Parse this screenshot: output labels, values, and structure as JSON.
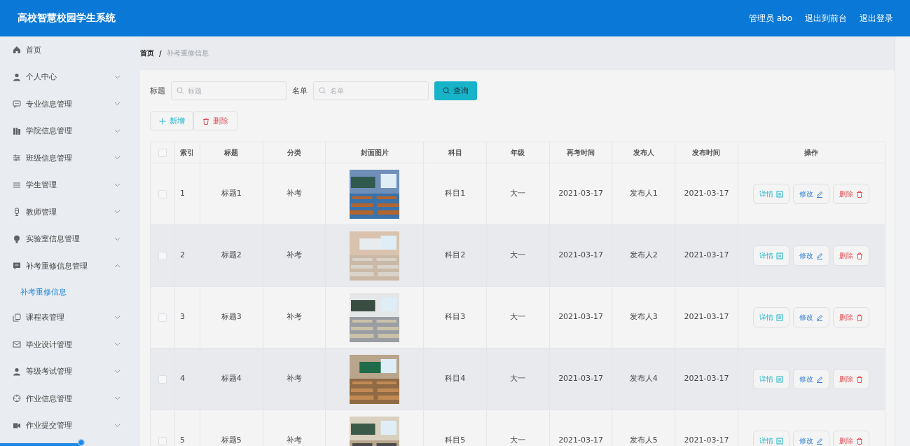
{
  "header": {
    "title": "高校智慧校园学生系统",
    "links": [
      "管理员 abo",
      "退出到前台",
      "退出登录"
    ]
  },
  "sidebar": {
    "items": [
      {
        "label": "首页",
        "kind": "link"
      },
      {
        "label": "个人中心",
        "kind": "submenu",
        "expanded": false
      },
      {
        "label": "专业信息管理",
        "kind": "submenu",
        "expanded": false
      },
      {
        "label": "学院信息管理",
        "kind": "submenu",
        "expanded": false
      },
      {
        "label": "班级信息管理",
        "kind": "submenu",
        "expanded": false
      },
      {
        "label": "学生管理",
        "kind": "submenu",
        "expanded": false
      },
      {
        "label": "教师管理",
        "kind": "submenu",
        "expanded": false
      },
      {
        "label": "实验室信息管理",
        "kind": "submenu",
        "expanded": false
      },
      {
        "label": "补考重修信息管理",
        "kind": "submenu",
        "expanded": true,
        "children": [
          {
            "label": "补考重修信息",
            "selected": true
          }
        ]
      },
      {
        "label": "课程表管理",
        "kind": "submenu",
        "expanded": false
      },
      {
        "label": "毕业设计管理",
        "kind": "submenu",
        "expanded": false
      },
      {
        "label": "等级考试管理",
        "kind": "submenu",
        "expanded": false
      },
      {
        "label": "作业信息管理",
        "kind": "submenu",
        "expanded": false
      },
      {
        "label": "作业提交管理",
        "kind": "submenu",
        "expanded": false
      }
    ]
  },
  "breadcrumb": {
    "separator": "/",
    "items": [
      "首页",
      "补考重修信息"
    ]
  },
  "search": {
    "fields": [
      {
        "label": "标题",
        "placeholder": "标题"
      },
      {
        "label": "名单",
        "placeholder": "名单"
      }
    ],
    "button": "查询"
  },
  "actions": [
    {
      "label": "新增",
      "kind": "add"
    },
    {
      "label": "删除",
      "kind": "delete"
    }
  ],
  "table": {
    "select_all": {
      "checked": false
    },
    "columns": [
      "索引",
      "标题",
      "分类",
      "封面图片",
      "科目",
      "年级",
      "再考时间",
      "发布人",
      "发布时间",
      "操作"
    ],
    "rows": [
      {
        "checked": false,
        "cells": [
          "1",
          "标题1",
          "补考",
          null,
          "科目1",
          "大一",
          "2021-03-17",
          "发布人1",
          "2021-03-17"
        ],
        "actions": [
          {
            "label": "详情",
            "kind": "detail"
          },
          {
            "label": "修改",
            "kind": "edit"
          },
          {
            "label": "删除",
            "kind": "delete"
          }
        ]
      },
      {
        "checked": false,
        "cells": [
          "2",
          "标题2",
          "补考",
          null,
          "科目2",
          "大一",
          "2021-03-17",
          "发布人2",
          "2021-03-17"
        ],
        "actions": [
          {
            "label": "详情",
            "kind": "detail"
          },
          {
            "label": "修改",
            "kind": "edit"
          },
          {
            "label": "删除",
            "kind": "delete"
          }
        ]
      },
      {
        "checked": false,
        "cells": [
          "3",
          "标题3",
          "补考",
          null,
          "科目3",
          "大一",
          "2021-03-17",
          "发布人3",
          "2021-03-17"
        ],
        "actions": [
          {
            "label": "详情",
            "kind": "detail"
          },
          {
            "label": "修改",
            "kind": "edit"
          },
          {
            "label": "删除",
            "kind": "delete"
          }
        ]
      },
      {
        "checked": false,
        "cells": [
          "4",
          "标题4",
          "补考",
          null,
          "科目4",
          "大一",
          "2021-03-17",
          "发布人4",
          "2021-03-17"
        ],
        "actions": [
          {
            "label": "详情",
            "kind": "detail"
          },
          {
            "label": "修改",
            "kind": "edit"
          },
          {
            "label": "删除",
            "kind": "delete"
          }
        ]
      },
      {
        "checked": false,
        "cells": [
          "5",
          "标题5",
          "补考",
          null,
          "科目5",
          "大一",
          "2021-03-17",
          "发布人5",
          "2021-03-17"
        ],
        "actions": [
          {
            "label": "详情",
            "kind": "detail"
          },
          {
            "label": "修改",
            "kind": "edit"
          },
          {
            "label": "删除",
            "kind": "delete"
          }
        ]
      }
    ]
  }
}
